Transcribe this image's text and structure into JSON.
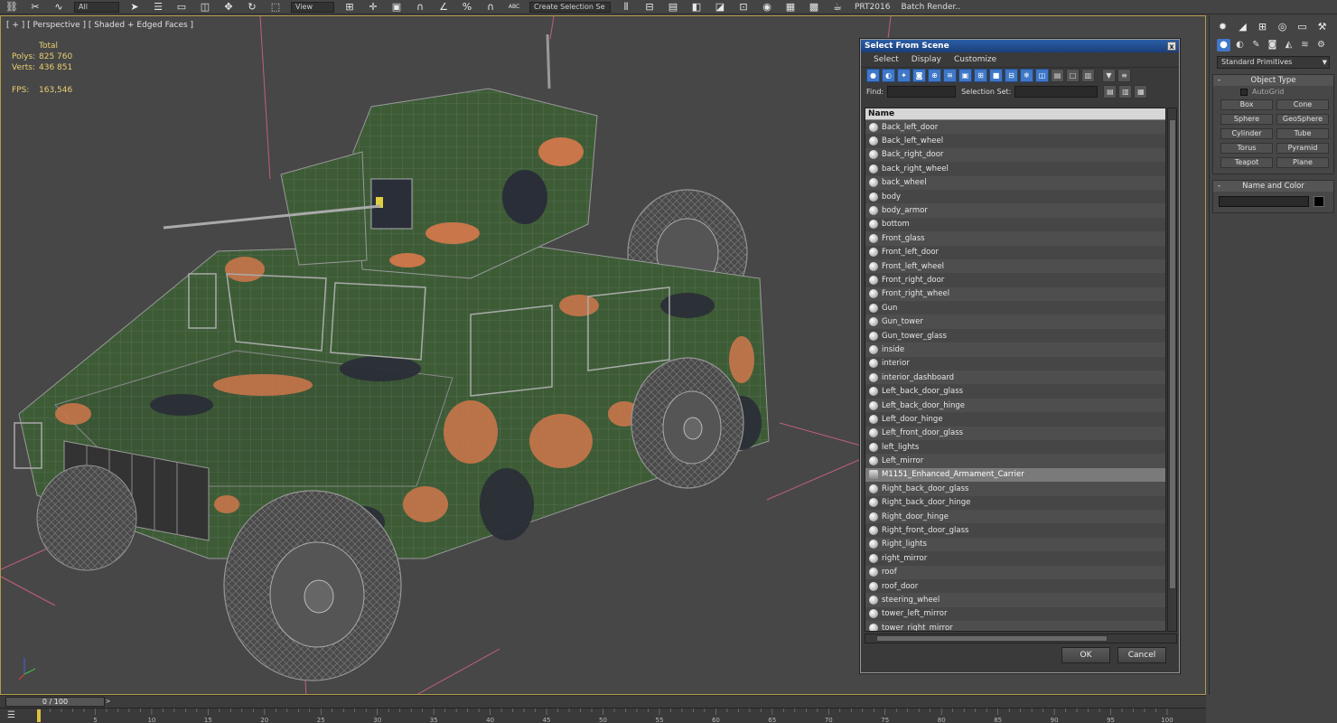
{
  "toolbar": {
    "selection_filter": "All",
    "view_combo": "View",
    "named_selection": "Create Selection Se",
    "prt_label": "PRT2016",
    "batch_render": "Batch Render..",
    "abc_label": "ABC"
  },
  "viewport": {
    "label": "[ + ] [ Perspective ] [ Shaded + Edged Faces ]",
    "stats": {
      "total_label": "Total",
      "polys_label": "Polys:",
      "polys_value": "825 760",
      "verts_label": "Verts:",
      "verts_value": "436 851",
      "fps_label": "FPS:",
      "fps_value": "163,546"
    }
  },
  "dialog": {
    "title": "Select From Scene",
    "close": "x",
    "menu": [
      "Select",
      "Display",
      "Customize"
    ],
    "find_label": "Find:",
    "selection_set_label": "Selection Set:",
    "column_name": "Name",
    "items": [
      "Back_left_door",
      "Back_left_wheel",
      "Back_right_door",
      "back_right_wheel",
      "back_wheel",
      "body",
      "body_armor",
      "bottom",
      "Front_glass",
      "Front_left_door",
      "Front_left_wheel",
      "Front_right_door",
      "Front_right_wheel",
      "Gun",
      "Gun_tower",
      "Gun_tower_glass",
      "inside",
      "interior",
      "interior_dashboard",
      "Left_back_door_glass",
      "Left_back_door_hinge",
      "Left_door_hinge",
      "Left_front_door_glass",
      "left_lights",
      "Left_mirror",
      "M1151_Enhanced_Armament_Carrier",
      "Right_back_door_glass",
      "Right_back_door_hinge",
      "Right_door_hinge",
      "Right_front_door_glass",
      "Right_lights",
      "right_mirror",
      "roof",
      "roof_door",
      "steering_wheel",
      "tower_left_mirror",
      "tower_right_mirror"
    ],
    "selected_item": "M1151_Enhanced_Armament_Carrier",
    "ok": "OK",
    "cancel": "Cancel"
  },
  "command_panel": {
    "category": "Standard Primitives",
    "object_type_header": "Object Type",
    "autogrid": "AutoGrid",
    "primitives": [
      "Box",
      "Cone",
      "Sphere",
      "GeoSphere",
      "Cylinder",
      "Tube",
      "Torus",
      "Pyramid",
      "Teapot",
      "Plane"
    ],
    "name_color_header": "Name and Color",
    "color": "#000000"
  },
  "timeline": {
    "frame": "0 / 100",
    "ticks": [
      "0",
      "5",
      "10",
      "15",
      "20",
      "25",
      "30",
      "35",
      "40",
      "45",
      "50",
      "55",
      "60",
      "65",
      "70",
      "75",
      "80",
      "85",
      "90",
      "95",
      "100"
    ]
  },
  "colors": {
    "accent": "#3f78c8",
    "viewport_border": "#b19a4a",
    "stats_text": "#e8d070",
    "camo_green": "#3d5c36",
    "camo_orange": "#c8764a",
    "camo_dark": "#2a2e38"
  }
}
